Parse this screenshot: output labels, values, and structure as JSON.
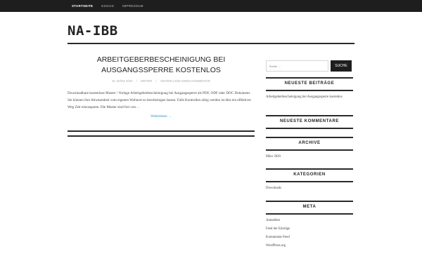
{
  "nav": {
    "items": [
      {
        "label": "STARTSEITE"
      },
      {
        "label": "ESSAIS"
      },
      {
        "label": "IMPRESSUM"
      }
    ]
  },
  "site": {
    "title": "NA-IBB"
  },
  "post": {
    "title": "ARBEITGEBERBESCHEINIGUNG BEI AUSGANGSSPERRE KOSTENLOS",
    "meta": {
      "date": "26. MÄRZ 2020",
      "author": "WRITER",
      "comments": "HINTERLASSE EINEN KOMMENTAR"
    },
    "excerpt": "Downloadbare kostenlose Muster / Vorlage Arbeitgeberbescheinigung bei Ausgangssperre als PDF, ODF oder DOC Dokument. Sie können ihre Abwesenheit vom eigenen Wohnort so bescheinigen lassen. Falls Kontrollen nötig werden ist dies ein effektiver Weg Zeit einzusparen. Die Muster sind frei von…",
    "read_more": "Weiterlesen →"
  },
  "search": {
    "placeholder": "Suche …",
    "button": "SUCHE"
  },
  "widgets": {
    "recent_posts": {
      "title": "NEUESTE BEITRÄGE",
      "items": [
        "Arbeitgeberbescheinigung bei Ausgangssperre kostenlos"
      ]
    },
    "recent_comments": {
      "title": "NEUESTE KOMMENTARE"
    },
    "archive": {
      "title": "ARCHIVE",
      "items": [
        "März 2020"
      ]
    },
    "categories": {
      "title": "KATEGORIEN",
      "items": [
        "Downloads"
      ]
    },
    "meta": {
      "title": "META",
      "items": [
        "Anmelden",
        "Feed der Einträge",
        "Kommentar-Feed",
        "WordPress.org"
      ]
    }
  }
}
